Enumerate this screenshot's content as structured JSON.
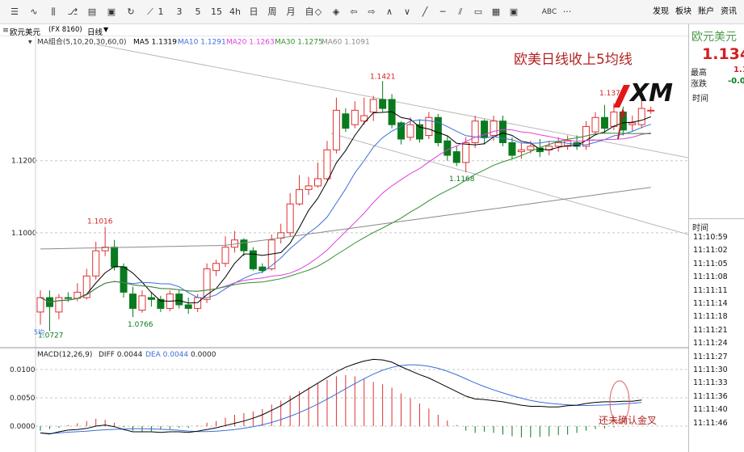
{
  "toolbar": {
    "icons": [
      "menu-icon",
      "line-chart-icon",
      "candlestick-icon",
      "indicator-icon",
      "layout-icon",
      "save-icon",
      "refresh-icon",
      "draw-icon"
    ],
    "periods": [
      "1",
      "3",
      "5",
      "15",
      "4h",
      "日",
      "周",
      "月",
      "自"
    ],
    "nav_icons": [
      "shrink-icon",
      "expand-icon",
      "arrow-left-icon",
      "arrow-right-icon",
      "zoom-in-icon",
      "zoom-out-icon",
      "trend-line-icon",
      "horizontal-line-icon",
      "parallel-line-icon",
      "fibonacci-icon",
      "channel-icon",
      "box-icon"
    ],
    "abc_label": "ABC",
    "more_label": "···",
    "right_links": [
      "发现",
      "板块",
      "账户",
      "资讯"
    ]
  },
  "header": {
    "symbol": "欧元美元",
    "code": "(FX 8160)",
    "period": "日线",
    "ma_group": "MA组合(5,10,20,30,60,0)",
    "ma5": "MA5 1.1319",
    "ma10": "MA10 1.1291",
    "ma20": "MA20 1.1263",
    "ma30": "MA30 1.1275",
    "ma60": "MA60 1.1091"
  },
  "colors": {
    "up": "#e03030",
    "down": "#0a7a1e",
    "ma5": "#000000",
    "ma10": "#3a6fd8",
    "ma20": "#e040e0",
    "ma30": "#2f8f2f",
    "ma60": "#8a8a8a",
    "diff": "#000000",
    "dea": "#3a6fd8",
    "annotation": "#b22222"
  },
  "price_axis": [
    "1.1200",
    "1.1000"
  ],
  "price_labels": {
    "high1": "1.1421",
    "high2": "1.1375",
    "low1": "1.1168",
    "high3": "1.1016",
    "low2": "1.0766",
    "low3": "1.0727"
  },
  "annotations": {
    "title": "欧美日线收上5均线",
    "macd_note": "还未确认金叉",
    "partial_label": "5均"
  },
  "macd": {
    "label": "MACD(12,26,9)",
    "diff": "DIFF 0.0044",
    "dea": "DEA 0.0044",
    "value": "0.0000",
    "axis": [
      "0.0100",
      "0.0050",
      "0.0000"
    ]
  },
  "side": {
    "name": "欧元美元",
    "price": "1.134",
    "high_label": "最高",
    "high_val": "1.1",
    "change_label": "涨跌",
    "change_val": "-0.0",
    "time_label": "时间",
    "time_label2": "时间",
    "times": [
      "11:10:59",
      "11:11:02",
      "11:11:05",
      "11:11:08",
      "11:11:11",
      "11:11:14",
      "11:11:18",
      "11:11:21",
      "11:11:24",
      "11:11:27",
      "11:11:30",
      "11:11:33",
      "11:11:36",
      "11:11:40",
      "11:11:46"
    ]
  },
  "logo": {
    "text": "XM"
  },
  "chart_data": {
    "type": "candlestick",
    "title": "",
    "price_range": [
      1.0681,
      1.1545
    ],
    "candles": [
      [
        1.078,
        1.082,
        1.084,
        1.0745
      ],
      [
        1.082,
        1.0795,
        1.084,
        1.0727
      ],
      [
        1.078,
        1.082,
        1.083,
        1.076
      ],
      [
        1.082,
        1.0818,
        1.0835,
        1.0808
      ],
      [
        1.0818,
        1.0835,
        1.086,
        1.081
      ],
      [
        1.082,
        1.088,
        1.09,
        1.0815
      ],
      [
        1.088,
        1.095,
        1.0975,
        1.087
      ],
      [
        1.095,
        1.096,
        1.1016,
        1.0935
      ],
      [
        1.096,
        1.0905,
        1.098,
        1.0895
      ],
      [
        1.0905,
        1.0835,
        1.0915,
        1.082
      ],
      [
        1.083,
        1.079,
        1.085,
        1.0766
      ],
      [
        1.0785,
        1.0825,
        1.084,
        1.0778
      ],
      [
        1.082,
        1.0815,
        1.0835,
        1.0795
      ],
      [
        1.0815,
        1.079,
        1.0825,
        1.078
      ],
      [
        1.079,
        1.083,
        1.084,
        1.0782
      ],
      [
        1.083,
        1.08,
        1.084,
        1.079
      ],
      [
        1.08,
        1.079,
        1.082,
        1.0775
      ],
      [
        1.079,
        1.082,
        1.083,
        1.078
      ],
      [
        1.0815,
        1.09,
        1.0915,
        1.0805
      ],
      [
        1.0895,
        1.0915,
        1.0925,
        1.088
      ],
      [
        1.0915,
        1.096,
        1.099,
        1.0905
      ],
      [
        1.096,
        1.098,
        1.1005,
        1.0945
      ],
      [
        1.098,
        1.095,
        1.0985,
        1.0935
      ],
      [
        1.095,
        1.09,
        1.096,
        1.0895
      ],
      [
        1.0905,
        1.0895,
        1.0915,
        1.0888
      ],
      [
        1.09,
        1.098,
        1.0995,
        1.0895
      ],
      [
        1.0985,
        1.1,
        1.1025,
        1.097
      ],
      [
        1.1,
        1.108,
        1.111,
        1.099
      ],
      [
        1.108,
        1.112,
        1.116,
        1.1075
      ],
      [
        1.112,
        1.113,
        1.1155,
        1.1105
      ],
      [
        1.113,
        1.115,
        1.1195,
        1.1125
      ],
      [
        1.115,
        1.123,
        1.1255,
        1.1145
      ],
      [
        1.123,
        1.134,
        1.1375,
        1.122
      ],
      [
        1.133,
        1.129,
        1.1345,
        1.128
      ],
      [
        1.13,
        1.134,
        1.1365,
        1.129
      ],
      [
        1.131,
        1.1325,
        1.1375,
        1.13
      ],
      [
        1.1335,
        1.137,
        1.138,
        1.131
      ],
      [
        1.137,
        1.1345,
        1.1421,
        1.1335
      ],
      [
        1.137,
        1.13,
        1.1385,
        1.129
      ],
      [
        1.1305,
        1.126,
        1.131,
        1.1245
      ],
      [
        1.1265,
        1.13,
        1.132,
        1.1255
      ],
      [
        1.13,
        1.126,
        1.1315,
        1.125
      ],
      [
        1.127,
        1.132,
        1.1335,
        1.126
      ],
      [
        1.132,
        1.125,
        1.133,
        1.124
      ],
      [
        1.1255,
        1.1215,
        1.127,
        1.12
      ],
      [
        1.1225,
        1.1195,
        1.124,
        1.1185
      ],
      [
        1.1195,
        1.125,
        1.1265,
        1.1168
      ],
      [
        1.125,
        1.131,
        1.1325,
        1.1235
      ],
      [
        1.131,
        1.1265,
        1.1315,
        1.1245
      ],
      [
        1.127,
        1.131,
        1.1325,
        1.1255
      ],
      [
        1.131,
        1.125,
        1.1325,
        1.124
      ],
      [
        1.125,
        1.1215,
        1.1265,
        1.1205
      ],
      [
        1.1225,
        1.123,
        1.125,
        1.1205
      ],
      [
        1.123,
        1.124,
        1.1255,
        1.122
      ],
      [
        1.1235,
        1.1225,
        1.126,
        1.121
      ],
      [
        1.123,
        1.124,
        1.1255,
        1.1215
      ],
      [
        1.124,
        1.125,
        1.1265,
        1.1225
      ],
      [
        1.124,
        1.1255,
        1.127,
        1.123
      ],
      [
        1.125,
        1.124,
        1.127,
        1.123
      ],
      [
        1.124,
        1.1295,
        1.131,
        1.123
      ],
      [
        1.128,
        1.132,
        1.1335,
        1.127
      ],
      [
        1.132,
        1.129,
        1.1355,
        1.1275
      ],
      [
        1.1295,
        1.1335,
        1.136,
        1.1285
      ],
      [
        1.1335,
        1.1285,
        1.135,
        1.127
      ],
      [
        1.13,
        1.1305,
        1.1325,
        1.128
      ],
      [
        1.13,
        1.1345,
        1.1375,
        1.129
      ],
      [
        1.134,
        1.134,
        1.135,
        1.133
      ]
    ]
  }
}
